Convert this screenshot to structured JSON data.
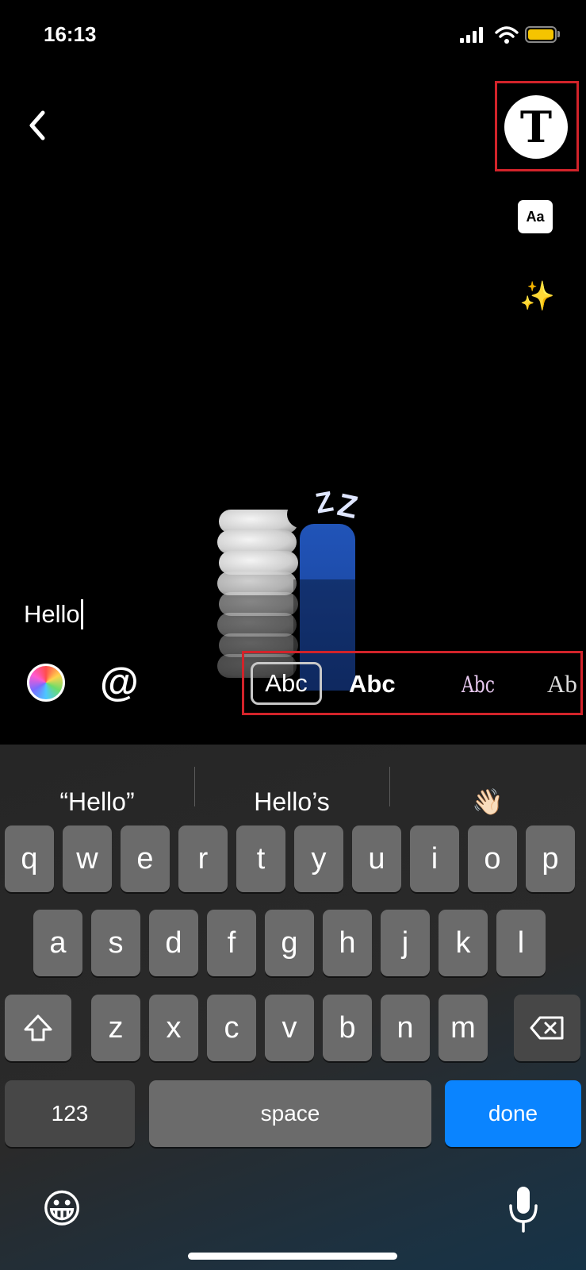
{
  "status": {
    "time": "16:13"
  },
  "editor": {
    "text": "Hello",
    "mention_symbol": "@"
  },
  "font_styles": [
    {
      "label": "Abc",
      "selected": true
    },
    {
      "label": "Abc",
      "selected": false
    },
    {
      "label": "Abc",
      "selected": false
    },
    {
      "label": "Ab",
      "selected": false
    }
  ],
  "tools": {
    "text_style_label": "T",
    "font_size_label": "Aa",
    "effects_emoji": "✨"
  },
  "suggestions": [
    "“Hello”",
    "Hello’s",
    "👋🏻"
  ],
  "keyboard": {
    "row1": [
      "q",
      "w",
      "e",
      "r",
      "t",
      "y",
      "u",
      "i",
      "o",
      "p"
    ],
    "row2": [
      "a",
      "s",
      "d",
      "f",
      "g",
      "h",
      "j",
      "k",
      "l"
    ],
    "row3": [
      "z",
      "x",
      "c",
      "v",
      "b",
      "n",
      "m"
    ],
    "numbers_label": "123",
    "space_label": "space",
    "done_label": "done",
    "emoji_glyph": "😀"
  },
  "colors": {
    "accent_done": "#0a84ff",
    "highlight": "#d2232a",
    "battery": "#f5c400"
  }
}
